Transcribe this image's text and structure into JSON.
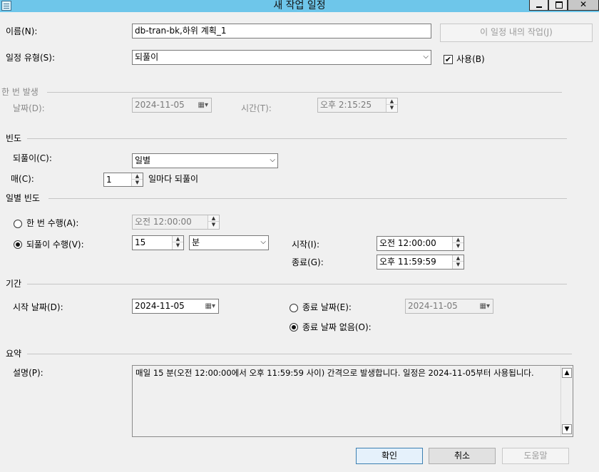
{
  "window": {
    "title": "새 작업 일정"
  },
  "name": {
    "label": "이름(N):",
    "value": "db-tran-bk,하위 계획_1",
    "jobs_button": "이 일정 내의 작업(J)"
  },
  "schedule_type": {
    "label": "일정 유형(S):",
    "value": "되풀이",
    "enabled_label": "사용(B)",
    "enabled_check": "✔"
  },
  "one_time": {
    "group": "한 번 발생",
    "date_label": "날짜(D):",
    "date_value": "2024-11-05",
    "time_label": "시간(T):",
    "time_value": "오후   2:15:25"
  },
  "frequency": {
    "group": "빈도",
    "occurs_label": "되풀이(C):",
    "occurs_value": "일별",
    "every_label": "매(C):",
    "every_value": "1",
    "every_suffix": "일마다 되풀이"
  },
  "daily": {
    "group": "일별 빈도",
    "once_label": "한 번 수행(A):",
    "once_value": "오전 12:00:00",
    "recurring_label": "되풀이 수행(V):",
    "recurring_value": "15",
    "recurring_unit": "분",
    "start_label": "시작(I):",
    "start_value": "오전 12:00:00",
    "end_label": "종료(G):",
    "end_value": "오후 11:59:59"
  },
  "duration": {
    "group": "기간",
    "start_label": "시작 날짜(D):",
    "start_value": "2024-11-05",
    "end_date_label": "종료 날짜(E):",
    "end_date_value": "2024-11-05",
    "no_end_label": "종료 날짜 없음(O):"
  },
  "summary": {
    "group": "요약",
    "desc_label": "설명(P):",
    "desc_value": "매일 15 분(오전 12:00:00에서 오후 11:59:59 사이) 간격으로 발생합니다. 일정은 2024-11-05부터 사용됩니다."
  },
  "buttons": {
    "ok": "확인",
    "cancel": "취소",
    "help": "도움말"
  }
}
